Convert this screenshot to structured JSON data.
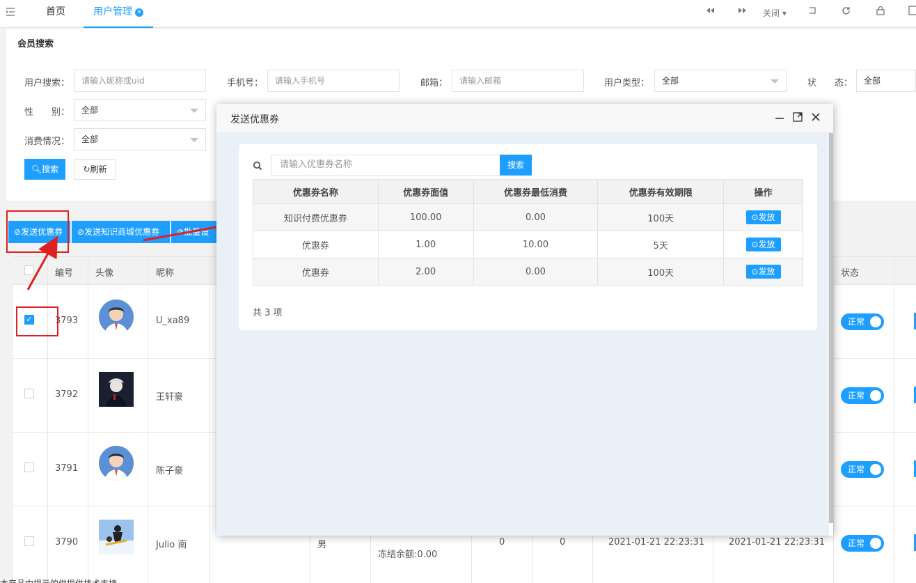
{
  "topbar": {
    "tabs": [
      {
        "label": "首页"
      },
      {
        "label": "用户管理"
      }
    ],
    "close_label": "关闭"
  },
  "search": {
    "title": "会员搜索",
    "fields": {
      "user_label": "用户搜索：",
      "user_placeholder": "请输入昵称或uid",
      "phone_label": "手机号：",
      "phone_placeholder": "请输入手机号",
      "email_label": "邮箱：",
      "email_placeholder": "请输入邮箱",
      "type_label": "用户类型：",
      "type_value": "全部",
      "status_label": "状　　态：",
      "status_value": "全部",
      "gender_label": "性　　别：",
      "gender_value": "全部",
      "consume_label": "消费情况：",
      "consume_value": "全部"
    },
    "search_button": "搜索",
    "refresh_button": "刷新"
  },
  "actions": {
    "send_coupon": "发送优惠券",
    "send_knowledge_coupon": "发送知识商城优惠券",
    "third": "批量设"
  },
  "table": {
    "headers": {
      "id": "编号",
      "avatar": "头像",
      "nickname": "昵称",
      "status": "状态"
    },
    "rows": [
      {
        "id": "3793",
        "nickname": "U_xa89",
        "status": "正常",
        "checked": true
      },
      {
        "id": "3792",
        "nickname": "王轩豪",
        "status": "正常",
        "checked": false
      },
      {
        "id": "3791",
        "nickname": "陈子豪",
        "status": "正常",
        "checked": false
      },
      {
        "id": "3790",
        "nickname": "Julio 南",
        "status": "正常",
        "checked": false,
        "gender": "男",
        "frozen": "冻结余额:0.00",
        "col_a": "0",
        "col_b": "0",
        "time1": "2021-01-21 22:23:31",
        "time2": "2021-01-21 22:23:31"
      }
    ]
  },
  "modal": {
    "title": "发送优惠券",
    "search_placeholder": "请输入优惠券名称",
    "search_button": "搜索",
    "headers": [
      "优惠券名称",
      "优惠券面值",
      "优惠券最低消费",
      "优惠券有效期限",
      "操作"
    ],
    "rows": [
      {
        "name": "知识付费优惠券",
        "value": "100.00",
        "min": "0.00",
        "validity": "100天",
        "action": "发放"
      },
      {
        "name": "优惠券",
        "value": "1.00",
        "min": "10.00",
        "validity": "5天",
        "action": "发放"
      },
      {
        "name": "优惠券",
        "value": "2.00",
        "min": "0.00",
        "validity": "100天",
        "action": "发放"
      }
    ],
    "total": "共 3 项"
  },
  "footer": "本产品中提示的供提供技术支持",
  "colors": {
    "accent": "#1e9fff",
    "annotation": "#e02020"
  }
}
